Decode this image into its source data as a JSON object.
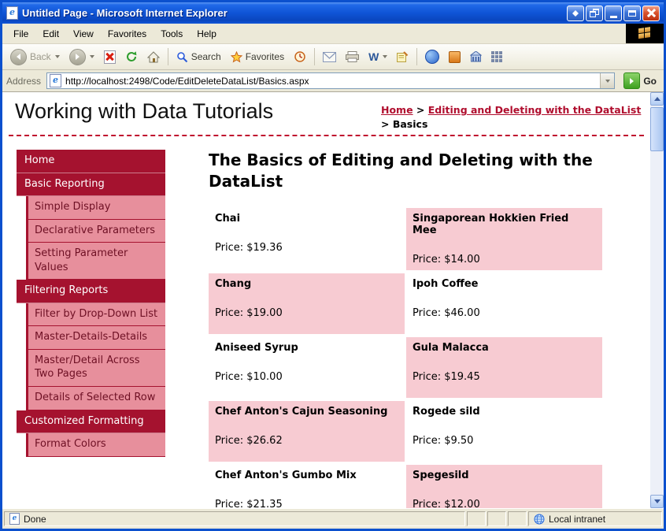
{
  "window": {
    "title": "Untitled Page - Microsoft Internet Explorer"
  },
  "menu": {
    "items": [
      "File",
      "Edit",
      "View",
      "Favorites",
      "Tools",
      "Help"
    ]
  },
  "toolbar": {
    "back_label": "Back",
    "search_label": "Search",
    "favorites_label": "Favorites",
    "word_glyph": "W"
  },
  "address": {
    "label": "Address",
    "url": "http://localhost:2498/Code/EditDeleteDataList/Basics.aspx",
    "go_label": "Go"
  },
  "page": {
    "site_title": "Working with Data Tutorials",
    "breadcrumb": {
      "home": "Home",
      "sep1": ">",
      "section": "Editing and Deleting with the DataList",
      "sep2": ">",
      "current": "Basics"
    },
    "heading": "The Basics of Editing and Deleting with the DataList",
    "sidebar": {
      "items": [
        {
          "label": "Home",
          "style": "dark"
        },
        {
          "label": "Basic Reporting",
          "style": "dark"
        },
        {
          "label": "Simple Display",
          "style": "pink"
        },
        {
          "label": "Declarative Parameters",
          "style": "pink"
        },
        {
          "label": "Setting Parameter Values",
          "style": "pink"
        },
        {
          "label": "Filtering Reports",
          "style": "dark"
        },
        {
          "label": "Filter by Drop-Down List",
          "style": "pink"
        },
        {
          "label": "Master-Details-Details",
          "style": "pink"
        },
        {
          "label": "Master/Detail Across Two Pages",
          "style": "pink"
        },
        {
          "label": "Details of Selected Row",
          "style": "pink"
        },
        {
          "label": "Customized Formatting",
          "style": "dark"
        },
        {
          "label": "Format Colors",
          "style": "pink"
        }
      ]
    },
    "products": [
      {
        "name": "Chai",
        "price": "Price: $19.36",
        "highlight": false
      },
      {
        "name": "Singaporean Hokkien Fried Mee",
        "price": "Price: $14.00",
        "highlight": true
      },
      {
        "name": "Chang",
        "price": "Price: $19.00",
        "highlight": true
      },
      {
        "name": "Ipoh Coffee",
        "price": "Price: $46.00",
        "highlight": false
      },
      {
        "name": "Aniseed Syrup",
        "price": "Price: $10.00",
        "highlight": false
      },
      {
        "name": "Gula Malacca",
        "price": "Price: $19.45",
        "highlight": true
      },
      {
        "name": "Chef Anton's Cajun Seasoning",
        "price": "Price: $26.62",
        "highlight": true
      },
      {
        "name": "Rogede sild",
        "price": "Price: $9.50",
        "highlight": false
      },
      {
        "name": "Chef Anton's Gumbo Mix",
        "price": "Price: $21.35",
        "highlight": false
      },
      {
        "name": "Spegesild",
        "price": "Price: $12.00",
        "highlight": true
      }
    ]
  },
  "statusbar": {
    "left": "Done",
    "right": "Local intranet"
  },
  "colors": {
    "titlebar_blue": "#0F54D6",
    "sidebar_dark_red": "#A5122F",
    "sidebar_pink": "#E78F9C",
    "cell_pink": "#F7CBD2",
    "link_red": "#B00E2E",
    "chrome_grey": "#ECE9D8"
  }
}
